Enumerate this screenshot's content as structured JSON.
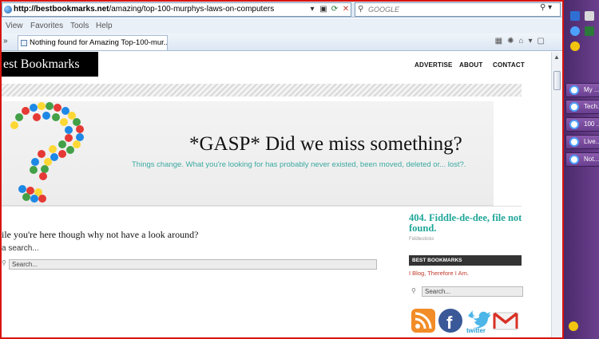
{
  "browser": {
    "url_host": "http://bestbookmarks.net",
    "url_path": "/amazing/top-100-murphys-laws-on-computers",
    "search_placeholder": "GOOGLE",
    "menu": [
      "View",
      "Favorites",
      "Tools",
      "Help"
    ],
    "tab_title": "Nothing found for Amazing Top-100-mur..."
  },
  "site": {
    "logo": "est Bookmarks",
    "nav": [
      "ADVERTISE",
      "ABOUT",
      "CONTACT"
    ],
    "banner_title": "*GASP* Did we miss something?",
    "banner_subtitle": "Things change. What you're looking for has probably never existed, been moved, deleted or... lost?.",
    "look_heading": "ile you're here though why not have a look around?",
    "search_label": "a search...",
    "search_placeholder": "Search...",
    "sidebar": {
      "title": "404. Fiddle-de-dee, file not found.",
      "small": "Fiddlesticks",
      "heading": "BEST BOOKMARKS",
      "link": "I Blog, Therefore I Am.",
      "search_placeholder": "Search..."
    },
    "social": [
      "rss-icon",
      "facebook-icon",
      "twitter-icon",
      "gmail-icon"
    ],
    "social_twitter_label": "twitter"
  },
  "taskbar": {
    "items": [
      "My ...",
      "Tech...",
      "100 ...",
      "Live...",
      "Not..."
    ]
  },
  "colors": {
    "frame": "#d7140f",
    "accent_teal": "#20a79a",
    "link_red": "#c0392b",
    "taskbar": "#6b3f8d"
  }
}
